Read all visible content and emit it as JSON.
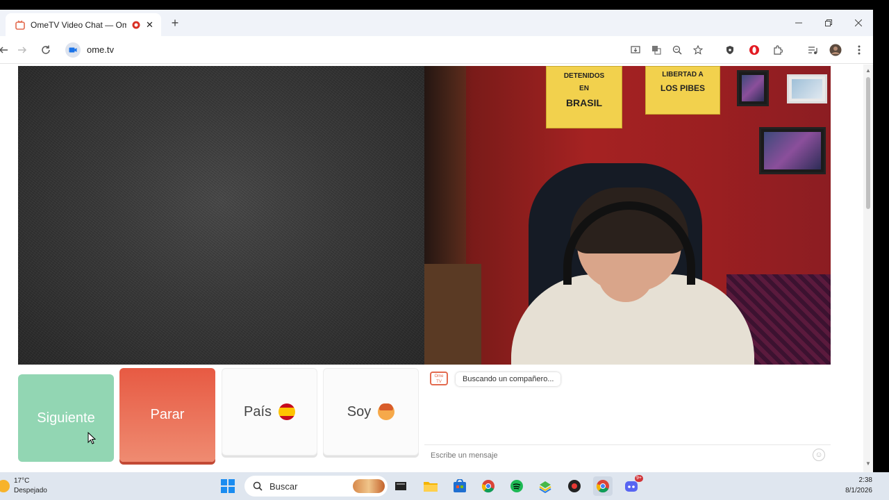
{
  "browser": {
    "tab_title": "OmeTV Video Chat — Ome",
    "url": "ome.tv",
    "new_tab": "+",
    "tab_close": "✕"
  },
  "page": {
    "controls": {
      "next_label": "Siguiente",
      "stop_label": "Parar",
      "country_label": "País",
      "gender_label": "Soy"
    },
    "chat": {
      "logo_text": "Ome TV",
      "status_message": "Buscando un compañero...",
      "input_placeholder": "Escribe un mensaje"
    },
    "remote_video": {
      "poster_left_lines": [
        "DETENIDOS",
        "EN",
        "BRASIL"
      ],
      "poster_right_lines": [
        "LIBERTAD A",
        "LOS PIBES"
      ]
    }
  },
  "taskbar": {
    "weather_temp": "17°C",
    "weather_desc": "Despejado",
    "search_label": "Buscar",
    "time": "2:38",
    "date": "8/1/2026",
    "notification_badge": "9+"
  },
  "colors": {
    "next_button": "#92d6b3",
    "stop_button": "#e75a43",
    "wall": "#a52222",
    "poster": "#f2d14d"
  }
}
